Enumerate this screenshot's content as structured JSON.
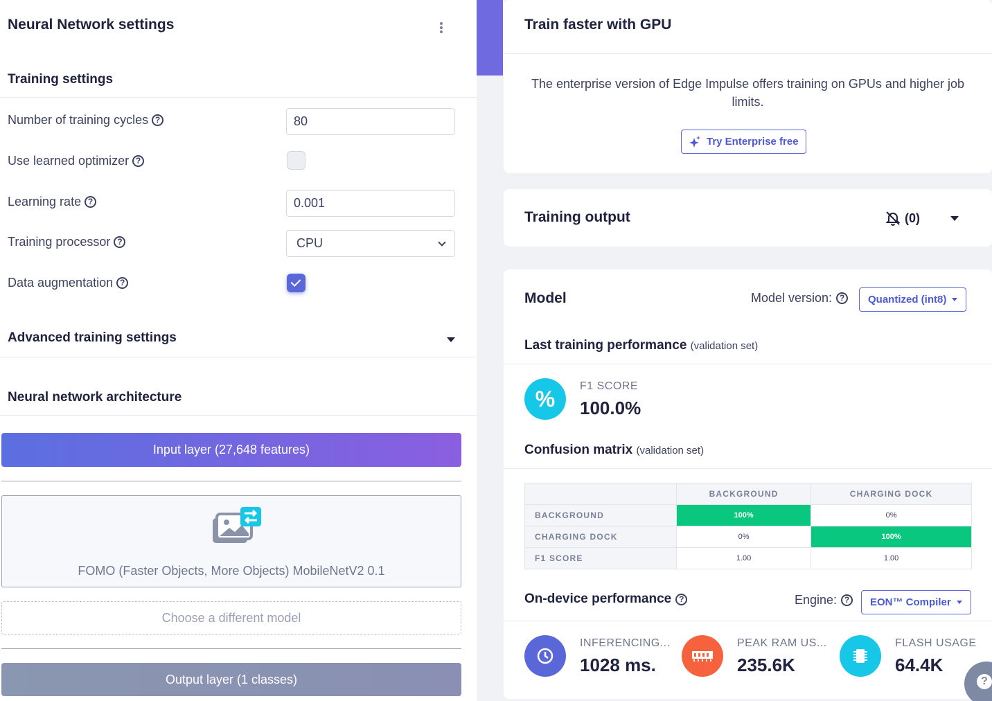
{
  "left": {
    "title": "Neural Network settings",
    "training_settings": {
      "heading": "Training settings",
      "cycles_label": "Number of training cycles",
      "cycles_value": "80",
      "learned_optimizer_label": "Use learned optimizer",
      "learned_optimizer_checked": false,
      "learning_rate_label": "Learning rate",
      "learning_rate_value": "0.001",
      "processor_label": "Training processor",
      "processor_value": "CPU",
      "augmentation_label": "Data augmentation",
      "augmentation_checked": true
    },
    "advanced_heading": "Advanced training settings",
    "architecture": {
      "heading": "Neural network architecture",
      "input_layer": "Input layer (27,648 features)",
      "model_name": "FOMO (Faster Objects, More Objects) MobileNetV2 0.1",
      "choose_model": "Choose a different model",
      "output_layer": "Output layer (1 classes)"
    }
  },
  "right": {
    "gpu_card": {
      "title": "Train faster with GPU",
      "text": "The enterprise version of Edge Impulse offers training on GPUs and higher job limits.",
      "button": "Try Enterprise free"
    },
    "training_output": {
      "title": "Training output",
      "count": "(0)"
    },
    "model": {
      "title": "Model",
      "version_label": "Model version:",
      "version_value": "Quantized (int8)",
      "last_perf_title": "Last training performance",
      "last_perf_note": "(validation set)",
      "f1_label": "F1 SCORE",
      "f1_value": "100.0%",
      "confusion_title": "Confusion matrix",
      "confusion_note": "(validation set)",
      "confusion": {
        "columns": [
          "BACKGROUND",
          "CHARGING DOCK"
        ],
        "rows": [
          {
            "label": "BACKGROUND",
            "cells": [
              "100%",
              "0%"
            ]
          },
          {
            "label": "CHARGING DOCK",
            "cells": [
              "0%",
              "100%"
            ]
          },
          {
            "label": "F1 SCORE",
            "cells": [
              "1.00",
              "1.00"
            ]
          }
        ]
      },
      "on_device_title": "On-device performance",
      "engine_label": "Engine:",
      "engine_value": "EON™ Compiler",
      "stats": [
        {
          "label": "INFERENCING...",
          "value": "1028 ms.",
          "color": "#5a67d8",
          "icon": "clock-icon"
        },
        {
          "label": "PEAK RAM US...",
          "value": "235.6K",
          "color": "#f5623d",
          "icon": "ram-icon"
        },
        {
          "label": "FLASH USAGE",
          "value": "64.4K",
          "color": "#17c7e8",
          "icon": "chip-icon"
        }
      ]
    }
  },
  "colors": {
    "accent": "#5a67d8",
    "success": "#0ac77f",
    "cyan": "#17c7e8"
  }
}
